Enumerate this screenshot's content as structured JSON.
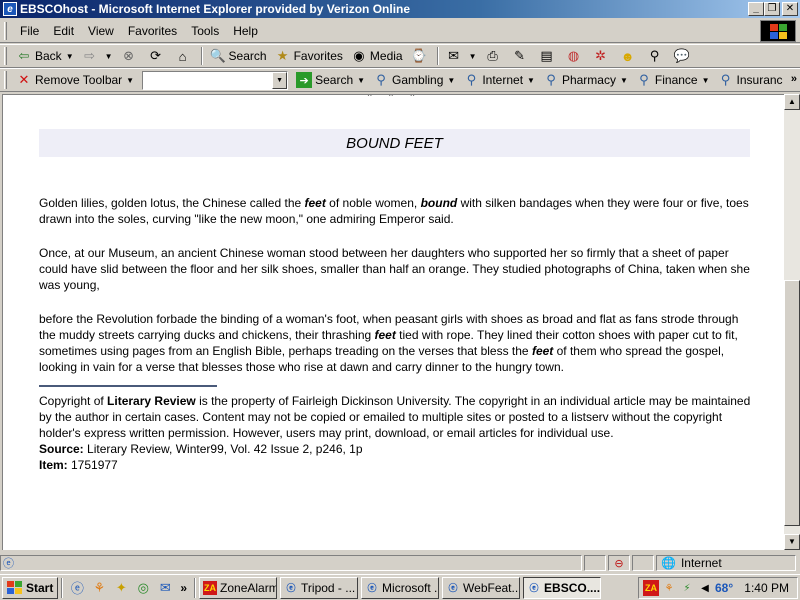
{
  "window": {
    "title": "EBSCOhost - Microsoft Internet Explorer provided by Verizon Online",
    "minimize": "_",
    "restore": "❐",
    "close": "✕"
  },
  "menu": {
    "items": [
      "File",
      "Edit",
      "View",
      "Favorites",
      "Tools",
      "Help"
    ]
  },
  "toolbar": {
    "back": "Back",
    "search": "Search",
    "favorites": "Favorites",
    "media": "Media"
  },
  "toolbar2": {
    "remove_toolbar": "Remove Toolbar",
    "search_value": "",
    "search_button": "Search",
    "links": [
      "Gambling",
      "Internet",
      "Pharmacy",
      "Finance",
      "Insuranc"
    ]
  },
  "page": {
    "stars": "* * *",
    "heading": "BOUND FEET",
    "paragraphs": {
      "p1": {
        "a": "Golden lilies, golden lotus, the Chinese called the ",
        "b": "feet",
        "c": " of noble women, ",
        "d": "bound",
        "e": " with silken bandages when they were four or five, toes drawn into the soles, curving \"like the new moon,\" one admiring Emperor said."
      },
      "p2": "Once, at our Museum, an ancient Chinese woman stood between her daughters who supported her so firmly that a sheet of paper could have slid between the floor and her silk shoes, smaller than half an orange. They studied photographs of China, taken when she was young,",
      "p3": {
        "a": "before the Revolution forbade the binding of a woman's foot, when peasant girls with shoes as broad and flat as fans strode through the muddy streets carrying ducks and chickens, their thrashing ",
        "b": "feet",
        "c": " tied with rope. They lined their cotton shoes with paper cut to fit, sometimes using pages from an English Bible, perhaps treading on the verses that bless the ",
        "d": "feet",
        "e": " of them who spread the gospel, looking in vain for a verse that blesses those who rise at dawn and carry dinner to the hungry town."
      }
    },
    "copyright": {
      "prefix": "Copyright of ",
      "publication": "Literary Review",
      "suffix": " is the property of Fairleigh Dickinson University. The copyright in an individual article may be maintained by the author in certain cases. Content may not be copied or emailed to multiple sites or posted to a listserv without the copyright holder's express written permission. However, users may print, download, or email articles for individual use."
    },
    "source_label": "Source:",
    "source_value": " Literary Review, Winter99, Vol. 42 Issue 2, p246, 1p",
    "item_label": "Item:",
    "item_value": " 1751977"
  },
  "status": {
    "zone": "Internet"
  },
  "taskbar": {
    "start": "Start",
    "chevron": "»",
    "tasks": [
      "ZoneAlarm",
      "Tripod - ...",
      "Microsoft ...",
      "WebFeat...",
      "EBSCO...."
    ],
    "active_index": 4,
    "temperature": "68°",
    "clock": "1:40 PM"
  }
}
